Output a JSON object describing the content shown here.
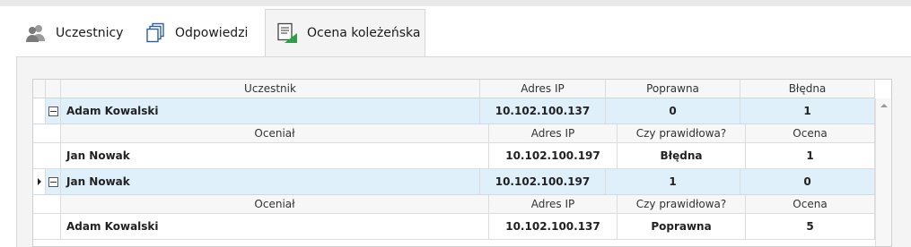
{
  "tabs": [
    {
      "label": "Uczestnicy",
      "icon": "users-icon"
    },
    {
      "label": "Odpowiedzi",
      "icon": "copies-icon"
    },
    {
      "label": "Ocena koleżeńska",
      "icon": "peer-review-icon",
      "active": true
    }
  ],
  "grid": {
    "columns": [
      "Uczestnik",
      "Adres IP",
      "Poprawna",
      "Błędna"
    ],
    "detail_columns": [
      "Oceniał",
      "Adres IP",
      "Czy prawidłowa?",
      "Ocena"
    ],
    "groups": [
      {
        "participant": "Adam Kowalski",
        "ip": "10.102.100.137",
        "correct": "0",
        "wrong": "1",
        "current": false,
        "reviews": [
          {
            "reviewer": "Jan Nowak",
            "ip": "10.102.100.197",
            "valid": "Błędna",
            "score": "1"
          }
        ]
      },
      {
        "participant": "Jan Nowak",
        "ip": "10.102.100.197",
        "correct": "1",
        "wrong": "0",
        "current": true,
        "reviews": [
          {
            "reviewer": "Adam Kowalski",
            "ip": "10.102.100.137",
            "valid": "Poprawna",
            "score": "5"
          }
        ]
      }
    ]
  },
  "colors": {
    "master_row": "#dff0fb",
    "header": "#f7f7f7",
    "accent_green": "#2ea043"
  }
}
